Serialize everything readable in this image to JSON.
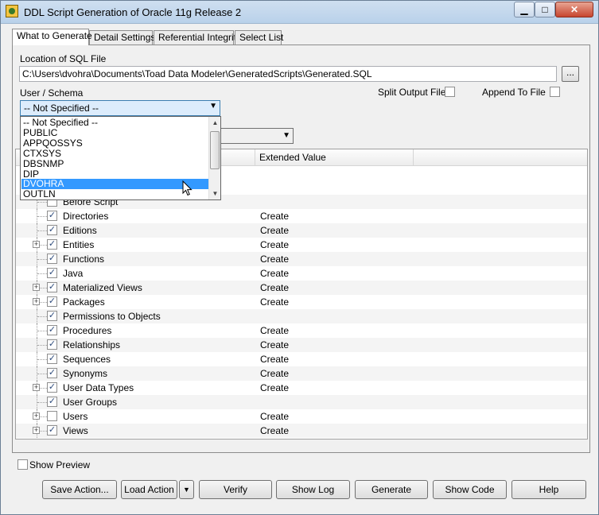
{
  "window": {
    "title": "DDL Script Generation of Oracle 11g Release 2"
  },
  "tabs": [
    {
      "label": "What to Generate",
      "active": true
    },
    {
      "label": "Detail Settings"
    },
    {
      "label": "Referential Integrity"
    },
    {
      "label": "Select List"
    }
  ],
  "location": {
    "label": "Location of SQL File",
    "path": "C:\\Users\\dvohra\\Documents\\Toad Data Modeler\\GeneratedScripts\\Generated.SQL",
    "browse_label": "..."
  },
  "schema": {
    "label": "User / Schema",
    "selected": "-- Not Specified --",
    "options": [
      "-- Not Specified --",
      "PUBLIC",
      "APPQOSSYS",
      "CTXSYS",
      "DBSNMP",
      "DIP",
      "DVOHRA",
      "OUTLN"
    ],
    "highlighted": "DVOHRA"
  },
  "options": {
    "split_output_label": "Split Output File",
    "append_label": "Append To File"
  },
  "grid": {
    "col_value_header": "Extended Value",
    "rows": [
      {
        "name": "Before Script",
        "value": "",
        "checked": false,
        "expandable": false
      },
      {
        "name": "Directories",
        "value": "Create",
        "checked": true,
        "expandable": false
      },
      {
        "name": "Editions",
        "value": "Create",
        "checked": true,
        "expandable": false
      },
      {
        "name": "Entities",
        "value": "Create",
        "checked": true,
        "expandable": true
      },
      {
        "name": "Functions",
        "value": "Create",
        "checked": true,
        "expandable": false
      },
      {
        "name": "Java",
        "value": "Create",
        "checked": true,
        "expandable": false
      },
      {
        "name": "Materialized Views",
        "value": "Create",
        "checked": true,
        "expandable": true
      },
      {
        "name": "Packages",
        "value": "Create",
        "checked": true,
        "expandable": true
      },
      {
        "name": "Permissions to Objects",
        "value": "",
        "checked": true,
        "expandable": false
      },
      {
        "name": "Procedures",
        "value": "Create",
        "checked": true,
        "expandable": false
      },
      {
        "name": "Relationships",
        "value": "Create",
        "checked": true,
        "expandable": false
      },
      {
        "name": "Sequences",
        "value": "Create",
        "checked": true,
        "expandable": false
      },
      {
        "name": "Synonyms",
        "value": "Create",
        "checked": true,
        "expandable": false
      },
      {
        "name": "User Data Types",
        "value": "Create",
        "checked": true,
        "expandable": true
      },
      {
        "name": "User Groups",
        "value": "",
        "checked": true,
        "expandable": false
      },
      {
        "name": "Users",
        "value": "Create",
        "checked": false,
        "expandable": true
      },
      {
        "name": "Views",
        "value": "Create",
        "checked": true,
        "expandable": true
      }
    ]
  },
  "show_preview_label": "Show Preview",
  "buttons": {
    "save_action": "Save Action...",
    "load_action": "Load Action",
    "verify": "Verify",
    "show_log": "Show Log",
    "generate": "Generate",
    "show_code": "Show Code",
    "help": "Help"
  }
}
